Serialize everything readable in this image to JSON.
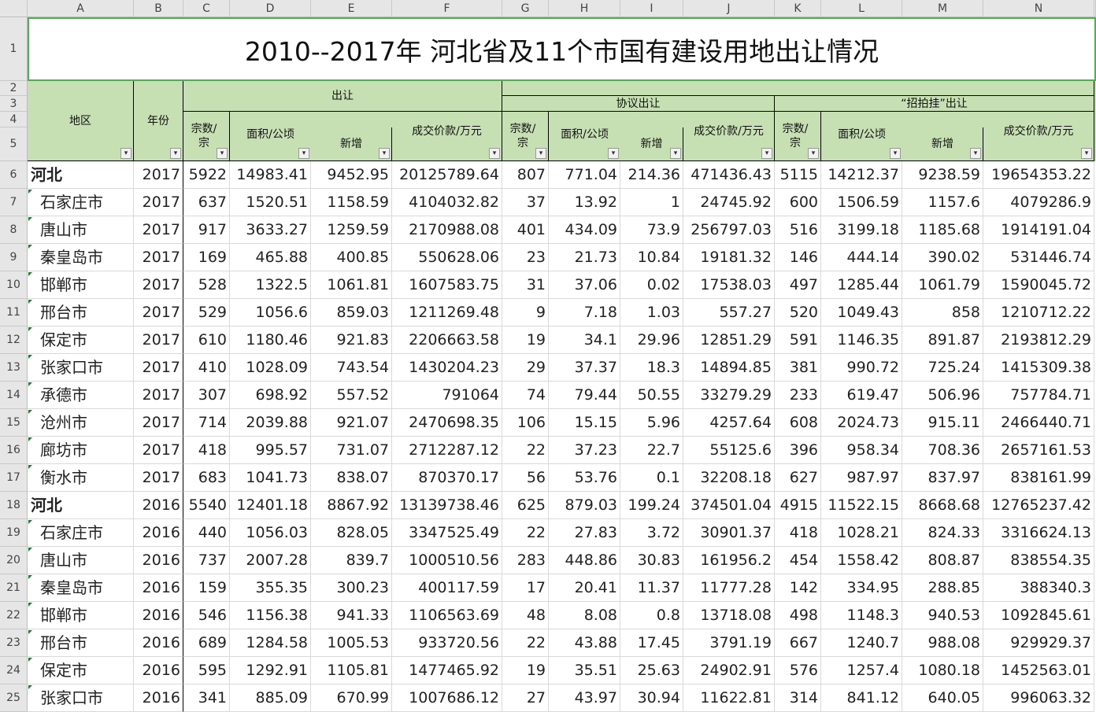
{
  "columns": [
    "A",
    "B",
    "C",
    "D",
    "E",
    "F",
    "G",
    "H",
    "I",
    "J",
    "K",
    "L",
    "M",
    "N"
  ],
  "title": "2010--2017年 河北省及11个市国有建设用地出让情况",
  "headers": {
    "region": "地区",
    "year": "年份",
    "transfer": "出让",
    "agreement": "协议出让",
    "auction": "“招拍挂”出让",
    "count": "宗数/宗",
    "area": "面积/公顷",
    "new": "新增",
    "price": "成交价款/万元",
    "filter_icon": "▾"
  },
  "rows": [
    {
      "n": 6,
      "region": "河北",
      "prov": true,
      "year": "2017",
      "v": [
        "5922",
        "14983.41",
        "9452.95",
        "20125789.64",
        "807",
        "771.04",
        "214.36",
        "471436.43",
        "5115",
        "14212.37",
        "9238.59",
        "19654353.22"
      ]
    },
    {
      "n": 7,
      "region": "石家庄市",
      "year": "2017",
      "v": [
        "637",
        "1520.51",
        "1158.59",
        "4104032.82",
        "37",
        "13.92",
        "1",
        "24745.92",
        "600",
        "1506.59",
        "1157.6",
        "4079286.9"
      ]
    },
    {
      "n": 8,
      "region": "唐山市",
      "year": "2017",
      "v": [
        "917",
        "3633.27",
        "1259.59",
        "2170988.08",
        "401",
        "434.09",
        "73.9",
        "256797.03",
        "516",
        "3199.18",
        "1185.68",
        "1914191.04"
      ]
    },
    {
      "n": 9,
      "region": "秦皇岛市",
      "year": "2017",
      "v": [
        "169",
        "465.88",
        "400.85",
        "550628.06",
        "23",
        "21.73",
        "10.84",
        "19181.32",
        "146",
        "444.14",
        "390.02",
        "531446.74"
      ]
    },
    {
      "n": 10,
      "region": "邯郸市",
      "year": "2017",
      "v": [
        "528",
        "1322.5",
        "1061.81",
        "1607583.75",
        "31",
        "37.06",
        "0.02",
        "17538.03",
        "497",
        "1285.44",
        "1061.79",
        "1590045.72"
      ]
    },
    {
      "n": 11,
      "region": "邢台市",
      "year": "2017",
      "v": [
        "529",
        "1056.6",
        "859.03",
        "1211269.48",
        "9",
        "7.18",
        "1.03",
        "557.27",
        "520",
        "1049.43",
        "858",
        "1210712.22"
      ]
    },
    {
      "n": 12,
      "region": "保定市",
      "year": "2017",
      "v": [
        "610",
        "1180.46",
        "921.83",
        "2206663.58",
        "19",
        "34.1",
        "29.96",
        "12851.29",
        "591",
        "1146.35",
        "891.87",
        "2193812.29"
      ]
    },
    {
      "n": 13,
      "region": "张家口市",
      "year": "2017",
      "v": [
        "410",
        "1028.09",
        "743.54",
        "1430204.23",
        "29",
        "37.37",
        "18.3",
        "14894.85",
        "381",
        "990.72",
        "725.24",
        "1415309.38"
      ]
    },
    {
      "n": 14,
      "region": "承德市",
      "year": "2017",
      "v": [
        "307",
        "698.92",
        "557.52",
        "791064",
        "74",
        "79.44",
        "50.55",
        "33279.29",
        "233",
        "619.47",
        "506.96",
        "757784.71"
      ]
    },
    {
      "n": 15,
      "region": "沧州市",
      "year": "2017",
      "v": [
        "714",
        "2039.88",
        "921.07",
        "2470698.35",
        "106",
        "15.15",
        "5.96",
        "4257.64",
        "608",
        "2024.73",
        "915.11",
        "2466440.71"
      ]
    },
    {
      "n": 16,
      "region": "廊坊市",
      "year": "2017",
      "v": [
        "418",
        "995.57",
        "731.07",
        "2712287.12",
        "22",
        "37.23",
        "22.7",
        "55125.6",
        "396",
        "958.34",
        "708.36",
        "2657161.53"
      ]
    },
    {
      "n": 17,
      "region": "衡水市",
      "year": "2017",
      "v": [
        "683",
        "1041.73",
        "838.07",
        "870370.17",
        "56",
        "53.76",
        "0.1",
        "32208.18",
        "627",
        "987.97",
        "837.97",
        "838161.99"
      ]
    },
    {
      "n": 18,
      "region": "河北",
      "prov": true,
      "year": "2016",
      "v": [
        "5540",
        "12401.18",
        "8867.92",
        "13139738.46",
        "625",
        "879.03",
        "199.24",
        "374501.04",
        "4915",
        "11522.15",
        "8668.68",
        "12765237.42"
      ]
    },
    {
      "n": 19,
      "region": "石家庄市",
      "year": "2016",
      "v": [
        "440",
        "1056.03",
        "828.05",
        "3347525.49",
        "22",
        "27.83",
        "3.72",
        "30901.37",
        "418",
        "1028.21",
        "824.33",
        "3316624.13"
      ]
    },
    {
      "n": 20,
      "region": "唐山市",
      "year": "2016",
      "v": [
        "737",
        "2007.28",
        "839.7",
        "1000510.56",
        "283",
        "448.86",
        "30.83",
        "161956.2",
        "454",
        "1558.42",
        "808.87",
        "838554.35"
      ]
    },
    {
      "n": 21,
      "region": "秦皇岛市",
      "year": "2016",
      "v": [
        "159",
        "355.35",
        "300.23",
        "400117.59",
        "17",
        "20.41",
        "11.37",
        "11777.28",
        "142",
        "334.95",
        "288.85",
        "388340.3"
      ]
    },
    {
      "n": 22,
      "region": "邯郸市",
      "year": "2016",
      "v": [
        "546",
        "1156.38",
        "941.33",
        "1106563.69",
        "48",
        "8.08",
        "0.8",
        "13718.08",
        "498",
        "1148.3",
        "940.53",
        "1092845.61"
      ]
    },
    {
      "n": 23,
      "region": "邢台市",
      "year": "2016",
      "v": [
        "689",
        "1284.58",
        "1005.53",
        "933720.56",
        "22",
        "43.88",
        "17.45",
        "3791.19",
        "667",
        "1240.7",
        "988.08",
        "929929.37"
      ]
    },
    {
      "n": 24,
      "region": "保定市",
      "year": "2016",
      "v": [
        "595",
        "1292.91",
        "1105.81",
        "1477465.92",
        "19",
        "35.51",
        "25.63",
        "24902.91",
        "576",
        "1257.4",
        "1080.18",
        "1452563.01"
      ]
    },
    {
      "n": 25,
      "region": "张家口市",
      "year": "2016",
      "v": [
        "341",
        "885.09",
        "670.99",
        "1007686.12",
        "27",
        "43.97",
        "30.94",
        "11622.81",
        "314",
        "841.12",
        "640.05",
        "996063.32"
      ]
    }
  ]
}
